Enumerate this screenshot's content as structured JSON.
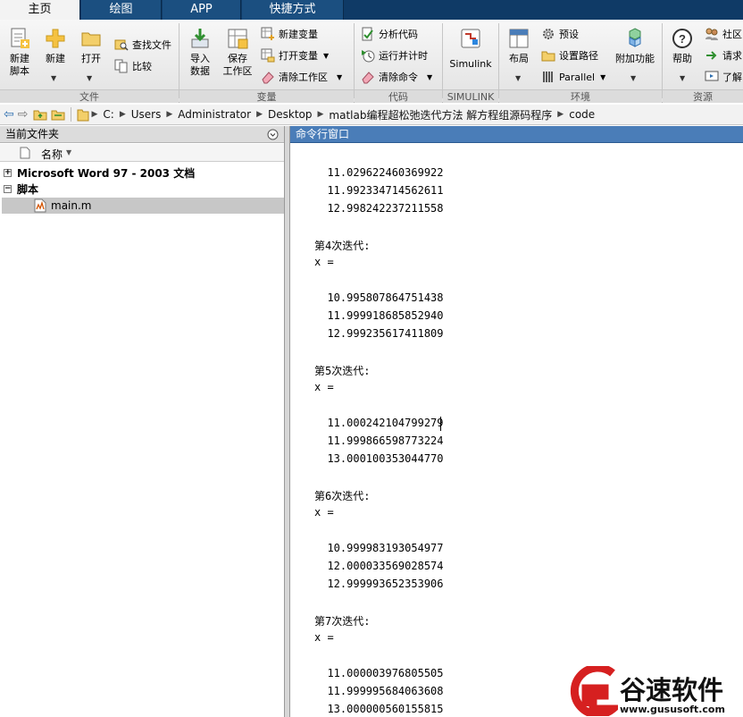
{
  "tabs": [
    "主页",
    "绘图",
    "APP",
    "快捷方式"
  ],
  "ribbon": {
    "file": {
      "new_script": "新建\n脚本",
      "new": "新建",
      "open": "打开",
      "find_files": "查找文件",
      "compare": "比较",
      "group": "文件"
    },
    "variable": {
      "import_data": "导入\n数据",
      "save_workspace": "保存\n工作区",
      "new_variable": "新建变量",
      "open_variable": "打开变量",
      "clear_workspace": "清除工作区",
      "group": "变量"
    },
    "code": {
      "analyze_code": "分析代码",
      "run_and_time": "运行并计时",
      "clear_commands": "清除命令",
      "group": "代码"
    },
    "simulink": {
      "simulink": "Simulink",
      "group": "SIMULINK"
    },
    "environment": {
      "layout": "布局",
      "preferences": "预设",
      "set_path": "设置路径",
      "parallel": "Parallel",
      "addons": "附加功能",
      "group": "环境"
    },
    "resources": {
      "help": "帮助",
      "community": "社区",
      "request_support": "请求",
      "learn": "了解",
      "group": "资源"
    }
  },
  "address": {
    "crumbs": [
      "C:",
      "Users",
      "Administrator",
      "Desktop",
      "matlab编程超松弛迭代方法 解方程组源码程序",
      "code"
    ]
  },
  "current_folder": {
    "title": "当前文件夹",
    "column_name": "名称",
    "items": [
      {
        "label": "Microsoft Word 97 - 2003 文档",
        "type": "group"
      },
      {
        "label": "脚本",
        "type": "group"
      },
      {
        "label": "main.m",
        "type": "file"
      }
    ]
  },
  "command_window": {
    "title": "命令行窗口",
    "lines": [
      "  11.029622460369922",
      "  11.992334714562611",
      "  12.998242237211558",
      "",
      "第4次迭代:",
      "x =",
      "",
      "  10.995807864751438",
      "  11.999918685852940",
      "  12.999235617411809",
      "",
      "第5次迭代:",
      "x =",
      "",
      "  11.000242104799279",
      "  11.999866598773224",
      "  13.000100353044770",
      "",
      "第6次迭代:",
      "x =",
      "",
      "  10.999983193054977",
      "  12.000033569028574",
      "  12.999993652353906",
      "",
      "第7次迭代:",
      "x =",
      "",
      "  11.000003976805505",
      "  11.999995684063608",
      "  13.000000560155815"
    ]
  },
  "watermark": {
    "brand": "谷速软件",
    "url": "www.gususoft.com"
  }
}
